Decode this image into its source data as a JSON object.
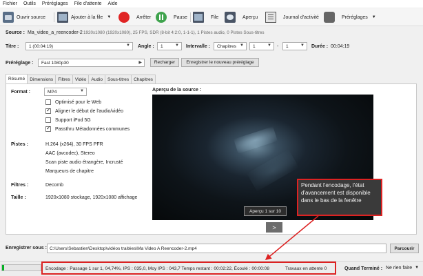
{
  "menu": [
    "Fichier",
    "Outils",
    "Préréglages",
    "File d'attente",
    "Aide"
  ],
  "toolbar": {
    "open_source": "Ouvrir source",
    "add_to_queue": "Ajouter à la file",
    "stop": "Arrêter",
    "pause": "Pause",
    "queue": "File",
    "preview": "Aperçu",
    "activity_log": "Journal d'activité",
    "presets": "Préréglages"
  },
  "source": {
    "label": "Source :",
    "name": "Ma_video_a_reencoder-2",
    "info": "1920x1080 (1920x1080), 25 FPS, SDR (8-bit 4:2:0, 1-1-1), 1 Pistes audio, 0 Pistes Sous-titres"
  },
  "title_row": {
    "title_label": "Titre :",
    "title_value": "1 (00:04:19)",
    "angle_label": "Angle :",
    "angle_value": "1",
    "range_label": "Intervalle :",
    "range_value": "Chapitres",
    "range_start": "1",
    "range_dash": "-",
    "range_end": "1",
    "duration_label": "Durée :",
    "duration_value": "00:04:19"
  },
  "preset": {
    "label": "Préréglage :",
    "value": "Fast 1080p30",
    "reload": "Recharger",
    "save_new": "Enregistrer le nouveau préréglage"
  },
  "tabs": [
    "Résumé",
    "Dimensions",
    "Filtres",
    "Vidéo",
    "Audio",
    "Sous-titres",
    "Chapitres"
  ],
  "summary": {
    "format_label": "Format :",
    "format_value": "MP4",
    "options": [
      {
        "label": "Optimisé pour le Web",
        "checked": false
      },
      {
        "label": "Aligner le début de l'audio/vidéo",
        "checked": true
      },
      {
        "label": "Support iPod 5G",
        "checked": false
      },
      {
        "label": "Passthru Métadonnées communes",
        "checked": true
      }
    ],
    "tracks_label": "Pistes :",
    "tracks": [
      "H.264 (x264), 30 FPS PFR",
      "AAC (avcodec), Stereo",
      "Scan piste audio étrangère, Incrusté",
      "Marqueurs de chapitre"
    ],
    "filters_label": "Filtres :",
    "filters_value": "Decomb",
    "size_label": "Taille :",
    "size_value": "1920x1080 stockage, 1920x1080 affichage",
    "preview_title": "Aperçu de la source :",
    "preview_counter": "Aperçu 1 sur 10",
    "next_symbol": ">"
  },
  "callout_text": "Pendant l'encodage, l'état d'avancement est disponible dans le bas de la fenêtre",
  "save": {
    "label": "Enregistrer sous :",
    "path": "C:\\Users\\Sebastien\\Desktop\\vidéos traitées\\Ma Video A Reencoder-2.mp4",
    "browse": "Parcourir"
  },
  "status": {
    "progress": 0.0474,
    "text": "Encodage : Passage 1 sur 1, 04,74%, IPS : 035,0, Moy IPS : 043,7 Temps restant : 00:02:22, Écoulé : 00:00:08",
    "pending": "Travaux en attente 0",
    "when_done_label": "Quand Terminé :",
    "when_done_value": "Ne rien faire"
  },
  "colors": {
    "stop": "#e02424",
    "pause": "#3fa34d",
    "highlight": "#dd2222",
    "progress": "#06b025"
  }
}
